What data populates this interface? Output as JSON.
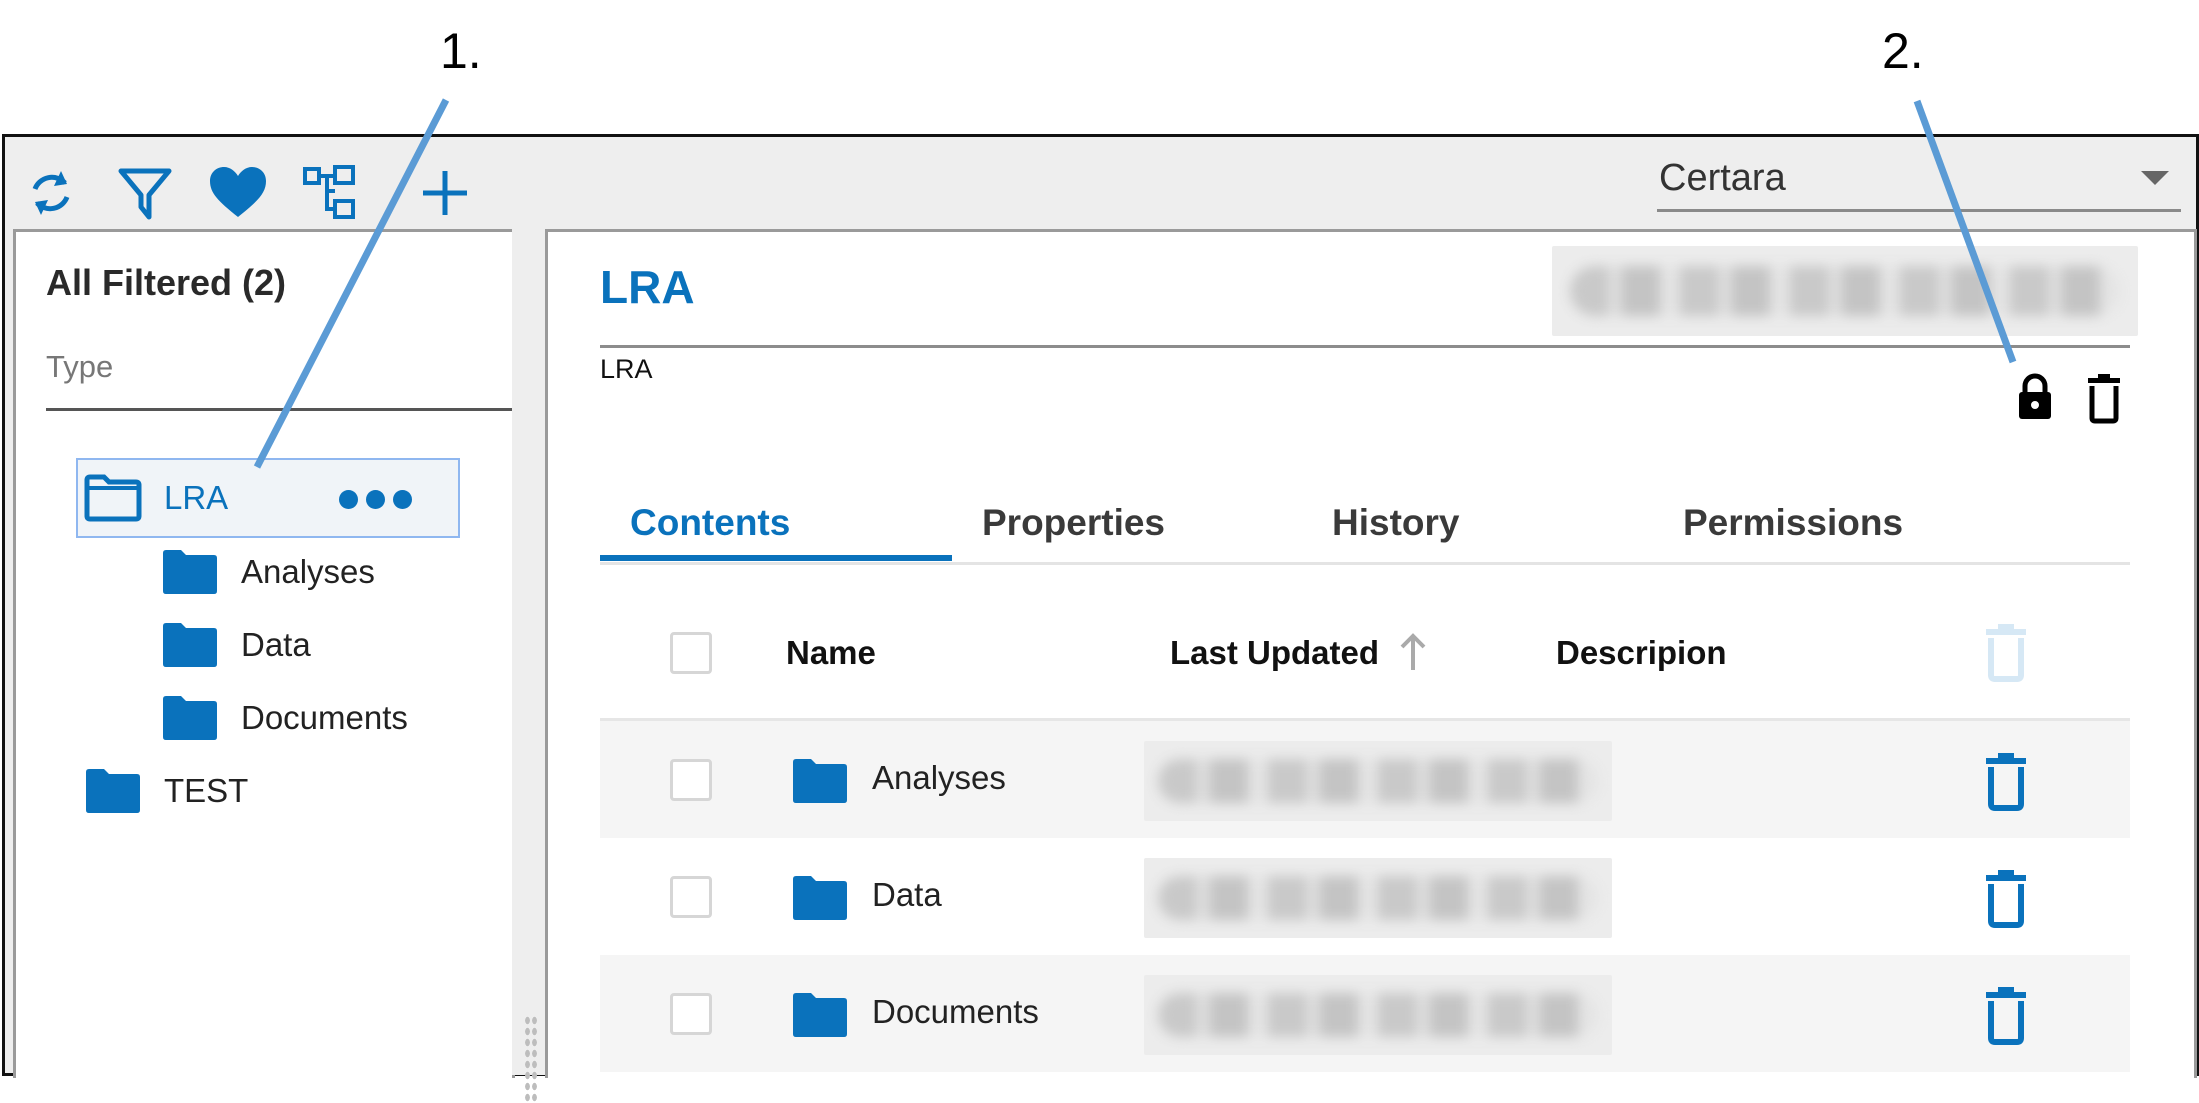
{
  "callouts": [
    {
      "label": "1."
    },
    {
      "label": "2."
    }
  ],
  "toolbar": {
    "icons": [
      {
        "name": "refresh-icon"
      },
      {
        "name": "filter-icon"
      },
      {
        "name": "favorites-heart-icon"
      },
      {
        "name": "hierarchy-tree-icon"
      },
      {
        "name": "add-plus-icon"
      }
    ],
    "workspace_dropdown": {
      "selected": "Certara"
    }
  },
  "sidebar": {
    "title": "All Filtered (2)",
    "filter_label": "Type",
    "tree": [
      {
        "label": "LRA",
        "level": 0,
        "selected": true,
        "icon": "folder-outline-icon",
        "has_menu": true
      },
      {
        "label": "Analyses",
        "level": 1,
        "icon": "folder-icon"
      },
      {
        "label": "Data",
        "level": 1,
        "icon": "folder-icon"
      },
      {
        "label": "Documents",
        "level": 1,
        "icon": "folder-icon"
      },
      {
        "label": "TEST",
        "level": 0,
        "icon": "folder-icon"
      }
    ]
  },
  "main": {
    "title": "LRA",
    "subtitle": "LRA",
    "header_actions": [
      "lock-icon",
      "trash-icon"
    ],
    "tabs": [
      {
        "label": "Contents",
        "active": true
      },
      {
        "label": "Properties",
        "active": false
      },
      {
        "label": "History",
        "active": false
      },
      {
        "label": "Permissions",
        "active": false
      }
    ],
    "table": {
      "columns": [
        "Name",
        "Last Updated",
        "Descripion"
      ],
      "sort": {
        "column": "Last Updated",
        "direction": "ascending"
      },
      "rows": [
        {
          "name": "Analyses",
          "last_updated": "[redacted]",
          "description": ""
        },
        {
          "name": "Data",
          "last_updated": "[redacted]",
          "description": ""
        },
        {
          "name": "Documents",
          "last_updated": "[redacted]",
          "description": ""
        }
      ]
    }
  },
  "colors": {
    "accent": "#0a72bc",
    "annotation": "#5b9bd5",
    "toolbar_bg": "#eeeeee",
    "row_shade": "#f5f5f5"
  }
}
